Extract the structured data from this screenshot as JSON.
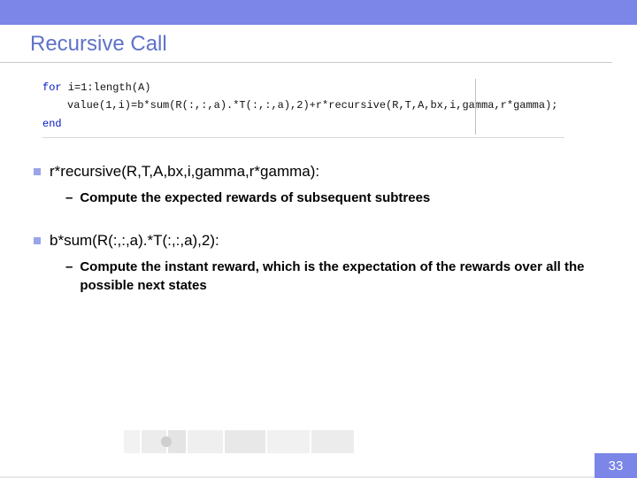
{
  "title": "Recursive Call",
  "code": {
    "line1_kw": "for",
    "line1_rest": " i=1:length(A)",
    "line2": "value(1,i)=b*sum(R(:,:,a).*T(:,:,a),2)+r*recursive(R,T,A,bx,i,gamma,r*gamma);",
    "line3_kw": "end"
  },
  "bullets": [
    {
      "text": "r*recursive(R,T,A,bx,i,gamma,r*gamma):",
      "sub": "Compute the expected rewards of subsequent subtrees"
    },
    {
      "text": "b*sum(R(:,:,a).*T(:,:,a),2):",
      "sub": "Compute the instant reward, which is the expectation of the rewards over all the possible next states"
    }
  ],
  "page_number": "33"
}
